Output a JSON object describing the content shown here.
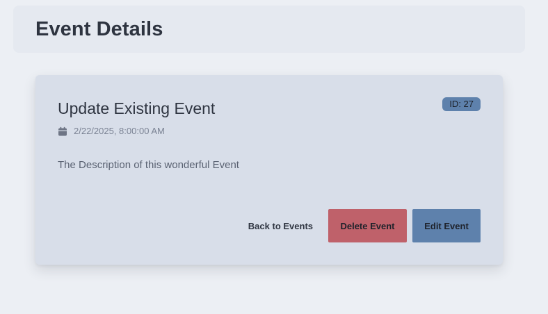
{
  "header": {
    "title": "Event Details"
  },
  "event": {
    "title": "Update Existing Event",
    "id_badge": "ID: 27",
    "date": "2/22/2025, 8:00:00 AM",
    "date_icon": "calendar-icon",
    "description": "The Description of this wonderful Event"
  },
  "actions": {
    "back_label": "Back to Events",
    "delete_label": "Delete Event",
    "edit_label": "Edit Event"
  },
  "colors": {
    "page_background": "#eceff4",
    "header_background": "#e5e9f0",
    "card_background": "#d8dee9",
    "badge": "#5e81ac",
    "delete": "#bf616a",
    "edit": "#5e81ac",
    "text": "#2e3440"
  }
}
